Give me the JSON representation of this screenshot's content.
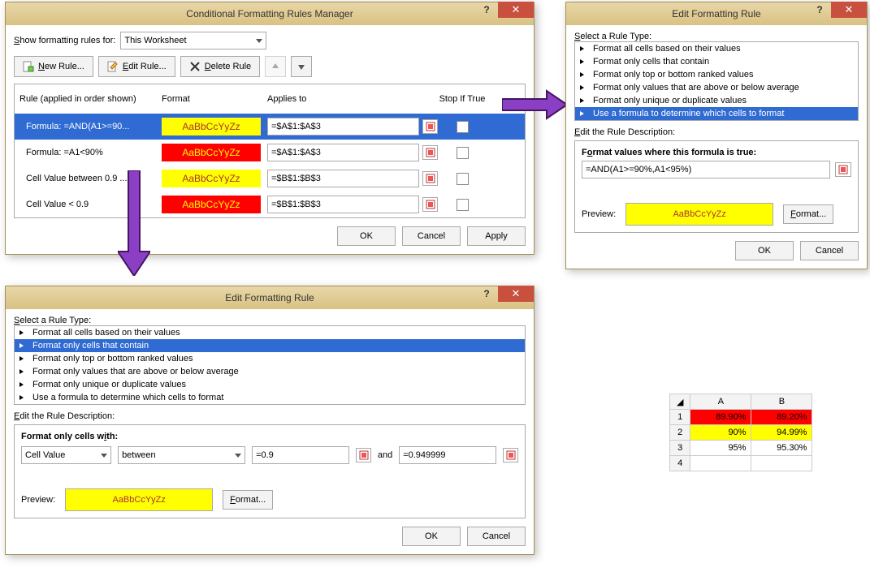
{
  "mgr": {
    "title": "Conditional Formatting Rules Manager",
    "show_label": "Show formatting rules for:",
    "scope": "This Worksheet",
    "new_btn": "New Rule...",
    "edit_btn": "Edit Rule...",
    "del_btn": "Delete Rule",
    "col_rule": "Rule (applied in order shown)",
    "col_fmt": "Format",
    "col_app": "Applies to",
    "col_stop": "Stop If True",
    "rows": [
      {
        "rule": "Formula: =AND(A1>=90...",
        "sample": "AaBbCcYyZz",
        "cls": "yellow",
        "applies": "=$A$1:$A$3",
        "selected": true
      },
      {
        "rule": "Formula: =A1<90%",
        "sample": "AaBbCcYyZz",
        "cls": "red",
        "applies": "=$A$1:$A$3",
        "selected": false
      },
      {
        "rule": "Cell Value between 0.9 ...",
        "sample": "AaBbCcYyZz",
        "cls": "yellow",
        "applies": "=$B$1:$B$3",
        "selected": false
      },
      {
        "rule": "Cell Value < 0.9",
        "sample": "AaBbCcYyZz",
        "cls": "red",
        "applies": "=$B$1:$B$3",
        "selected": false
      }
    ],
    "ok": "OK",
    "cancel": "Cancel",
    "apply": "Apply"
  },
  "edit1": {
    "title": "Edit Formatting Rule",
    "select_label": "Select a Rule Type:",
    "types": [
      "Format all cells based on their values",
      "Format only cells that contain",
      "Format only top or bottom ranked values",
      "Format only values that are above or below average",
      "Format only unique or duplicate values",
      "Use a formula to determine which cells to format"
    ],
    "selected_index": 5,
    "desc_label": "Edit the Rule Description:",
    "formula_label": "Format values where this formula is true:",
    "formula": "=AND(A1>=90%,A1<95%)",
    "preview_label": "Preview:",
    "preview_text": "AaBbCcYyZz",
    "format_btn": "Format...",
    "ok": "OK",
    "cancel": "Cancel"
  },
  "edit2": {
    "title": "Edit Formatting Rule",
    "select_label": "Select a Rule Type:",
    "types": [
      "Format all cells based on their values",
      "Format only cells that contain",
      "Format only top or bottom ranked values",
      "Format only values that are above or below average",
      "Format only unique or duplicate values",
      "Use a formula to determine which cells to format"
    ],
    "selected_index": 1,
    "desc_label": "Edit the Rule Description:",
    "cells_with_label": "Format only cells with:",
    "op1": "Cell Value",
    "op2": "between",
    "val1": "=0.9",
    "and_label": "and",
    "val2": "=0.949999",
    "preview_label": "Preview:",
    "preview_text": "AaBbCcYyZz",
    "format_btn": "Format...",
    "ok": "OK",
    "cancel": "Cancel"
  },
  "sheet": {
    "cols": [
      "A",
      "B"
    ],
    "rows": [
      {
        "n": "1",
        "a": "89.90%",
        "b": "89.20%",
        "acls": "cell-red",
        "bcls": "cell-red"
      },
      {
        "n": "2",
        "a": "90%",
        "b": "94.99%",
        "acls": "cell-yellow",
        "bcls": "cell-yellow"
      },
      {
        "n": "3",
        "a": "95%",
        "b": "95.30%",
        "acls": "",
        "bcls": ""
      },
      {
        "n": "4",
        "a": "",
        "b": "",
        "acls": "",
        "bcls": ""
      }
    ]
  }
}
